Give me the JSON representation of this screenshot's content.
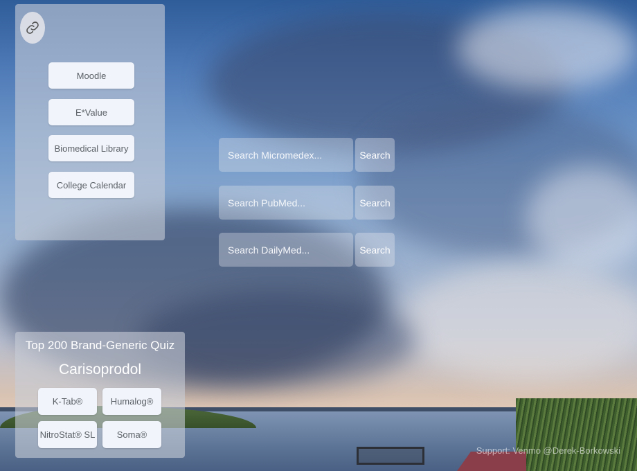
{
  "links": {
    "icon": "link-icon",
    "items": [
      {
        "label": "Moodle"
      },
      {
        "label": "E*Value"
      },
      {
        "label": "Biomedical Library"
      },
      {
        "label": "College Calendar"
      }
    ]
  },
  "searches": [
    {
      "placeholder": "Search Micromedex...",
      "button_label": "Search"
    },
    {
      "placeholder": "Search PubMed...",
      "button_label": "Search"
    },
    {
      "placeholder": "Search DailyMed...",
      "button_label": "Search"
    }
  ],
  "quiz": {
    "title": "Top 200 Brand-Generic Quiz",
    "drug": "Carisoprodol",
    "options": [
      {
        "label": "K-Tab®"
      },
      {
        "label": "Humalog®"
      },
      {
        "label": "NitroStat® SL"
      },
      {
        "label": "Soma®"
      }
    ]
  },
  "footer": {
    "support_text": "Support: Venmo @Derek-Borkowski"
  },
  "colors": {
    "button_bg": "#f1f5fb",
    "button_text": "#5a5f66",
    "panel_bg": "rgba(200,205,215,0.6)"
  }
}
